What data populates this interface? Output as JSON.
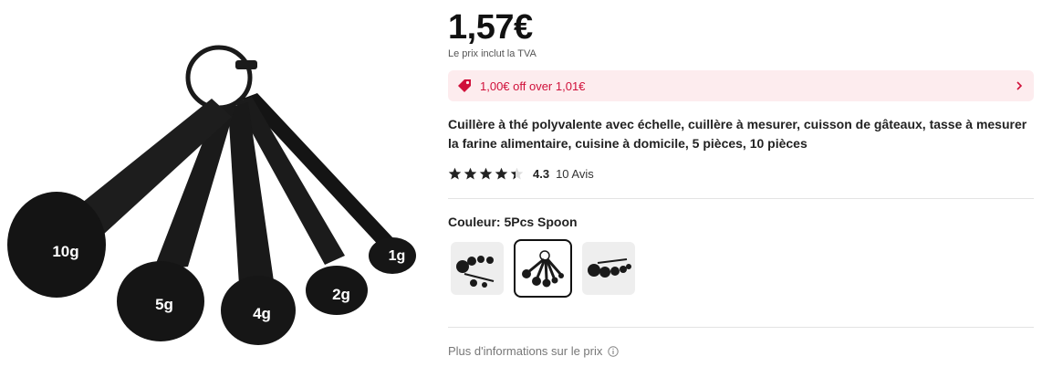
{
  "product": {
    "image_labels": [
      "10g",
      "5g",
      "4g",
      "2g",
      "1g"
    ],
    "price": "1,57€",
    "vat_note": "Le prix inclut la TVA",
    "promo": {
      "text": "1,00€ off over 1,01€",
      "icon": "price-tag-icon",
      "accent": "#d0103a",
      "background": "#fdecee"
    },
    "title": "Cuillère à thé polyvalente avec échelle, cuillère à mesurer, cuisson de gâteaux, tasse à mesurer la farine alimentaire, cuisine à domicile, 5 pièces, 10 pièces",
    "rating": {
      "value": "4.3",
      "stars": 4.3,
      "max": 5,
      "reviews": "10 Avis"
    },
    "color": {
      "label": "Couleur:",
      "selected": "5Pcs Spoon",
      "swatch_count": 3,
      "selected_index": 1
    },
    "more_info": "Plus d'informations sur le prix"
  }
}
